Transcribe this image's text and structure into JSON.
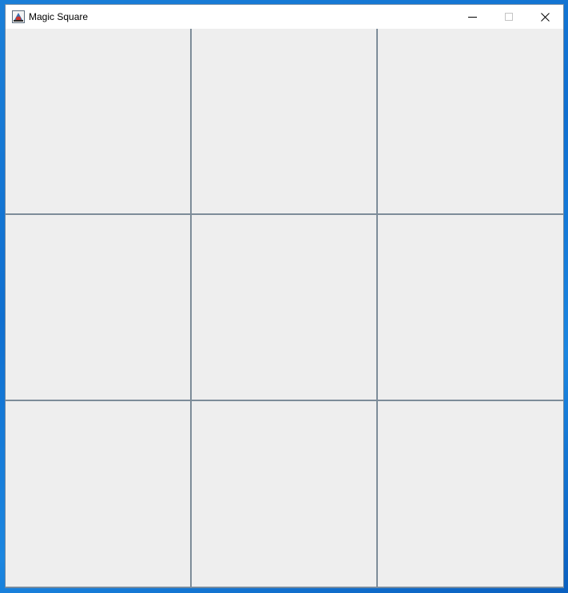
{
  "window": {
    "title": "Magic Square",
    "icon": "java-app-icon",
    "controls": {
      "minimize": "minimize-icon",
      "maximize": "maximize-icon",
      "close": "close-icon"
    }
  },
  "grid": {
    "rows": 3,
    "cols": 3,
    "cells": [
      {
        "row": 1,
        "col": 1,
        "value": ""
      },
      {
        "row": 1,
        "col": 2,
        "value": ""
      },
      {
        "row": 1,
        "col": 3,
        "value": ""
      },
      {
        "row": 2,
        "col": 1,
        "value": ""
      },
      {
        "row": 2,
        "col": 2,
        "value": ""
      },
      {
        "row": 2,
        "col": 3,
        "value": ""
      },
      {
        "row": 3,
        "col": 1,
        "value": ""
      },
      {
        "row": 3,
        "col": 2,
        "value": ""
      },
      {
        "row": 3,
        "col": 3,
        "value": ""
      }
    ],
    "colors": {
      "cell_background": "#eeeeee",
      "grid_lines": "#7d8c99"
    }
  }
}
